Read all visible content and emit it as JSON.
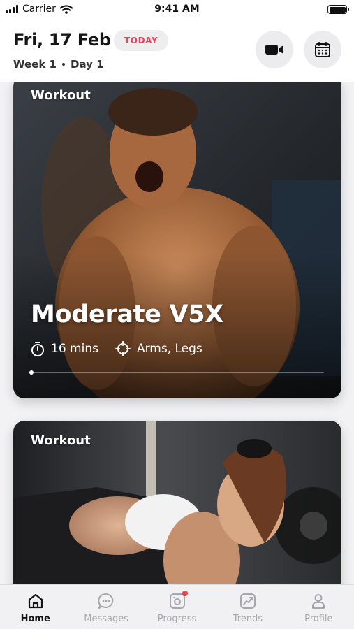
{
  "status_bar": {
    "carrier": "Carrier",
    "time": "9:41 AM"
  },
  "header": {
    "date": "Fri, 17 Feb",
    "today_badge": "TODAY",
    "week": "Week 1",
    "day": "Day 1",
    "video_button_icon": "video-camera-icon",
    "calendar_button_icon": "calendar-icon"
  },
  "cards": [
    {
      "tag": "Workout",
      "title": "Moderate V5X",
      "duration": "16 mins",
      "targets": "Arms, Legs",
      "progress": 0.0
    },
    {
      "tag": "Workout"
    }
  ],
  "tabs": [
    {
      "label": "Home",
      "icon": "home-icon",
      "active": true
    },
    {
      "label": "Messages",
      "icon": "chat-bubble-icon",
      "active": false
    },
    {
      "label": "Progress",
      "icon": "camera-icon",
      "active": false,
      "badge": true
    },
    {
      "label": "Trends",
      "icon": "trend-chart-icon",
      "active": false
    },
    {
      "label": "Profile",
      "icon": "person-icon",
      "active": false
    }
  ],
  "colors": {
    "accent": "#e0465e",
    "badge": "#e5484d",
    "tab_inactive": "#a7a7ad"
  }
}
